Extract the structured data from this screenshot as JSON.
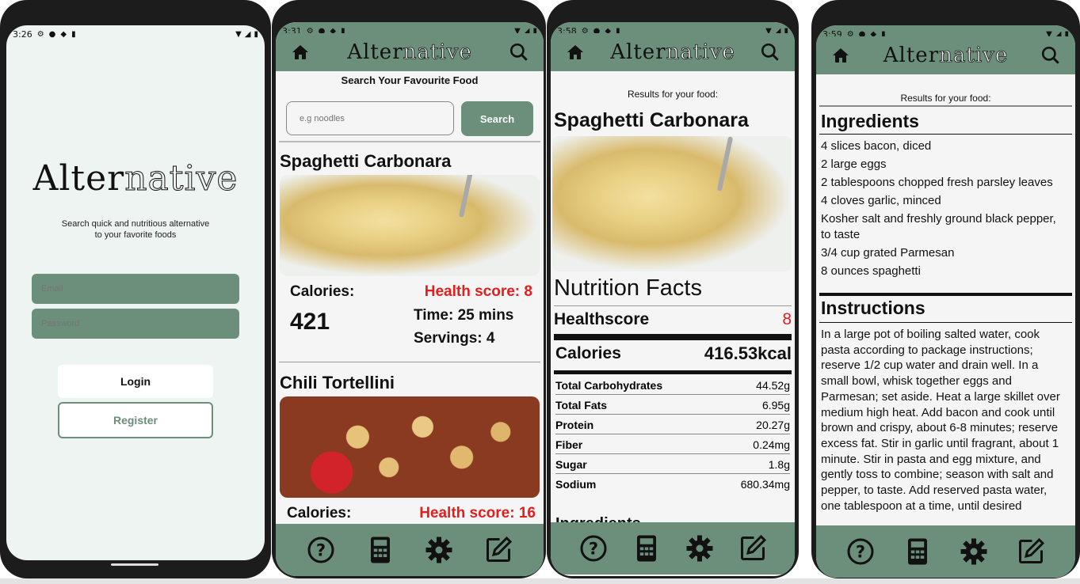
{
  "colors": {
    "primary": "#6c8f7b",
    "health_red": "#e02020",
    "screen_bg_login": "#eef4f2",
    "screen_bg": "#f5f5f5"
  },
  "brand": {
    "logo_solid": "Alter",
    "logo_outline": "native"
  },
  "screen1": {
    "time": "3:26",
    "tagline": "Search quick and nutritious alternative\nto your favorite foods",
    "email_placeholder": "Email",
    "password_placeholder": "Password",
    "login_label": "Login",
    "register_label": "Register"
  },
  "screen2": {
    "time": "3:31",
    "heading": "Search Your Favourite Food",
    "search_placeholder": "e.g noodles",
    "search_button": "Search",
    "results": [
      {
        "title": "Spaghetti Carbonara",
        "calories_label": "Calories:",
        "calories": "421",
        "health": "Health score: 8",
        "time": "Time: 25 mins",
        "servings": "Servings: 4"
      },
      {
        "title": "Chili Tortellini",
        "calories_label": "Calories:",
        "health": "Health score: 16"
      }
    ]
  },
  "screen3": {
    "time": "3:58",
    "results_label": "Results for your food:",
    "title": "Spaghetti Carbonara",
    "nutrition_heading": "Nutrition Facts",
    "healthscore_label": "Healthscore",
    "healthscore_value": "8",
    "calories_label": "Calories",
    "calories_value": "416.53kcal",
    "rows": [
      {
        "label": "Total Carbohydrates",
        "value": "44.52g"
      },
      {
        "label": "Total Fats",
        "value": "6.95g"
      },
      {
        "label": "Protein",
        "value": "20.27g"
      },
      {
        "label": "Fiber",
        "value": "0.24mg"
      },
      {
        "label": "Sugar",
        "value": "1.8g"
      },
      {
        "label": "Sodium",
        "value": "680.34mg"
      }
    ],
    "cut_heading": "Ingredients"
  },
  "screen4": {
    "time": "3:59",
    "results_label": "Results for your food:",
    "ingredients_heading": "Ingredients",
    "ingredients": [
      "4 slices bacon, diced",
      "2 large eggs",
      "2 tablespoons chopped fresh parsley leaves",
      "4 cloves garlic, minced",
      "Kosher salt and freshly ground black pepper, to taste",
      "3/4 cup grated Parmesan",
      "8 ounces spaghetti"
    ],
    "instructions_heading": "Instructions",
    "instructions": "In a large pot of boiling salted water, cook pasta according to package instructions; reserve 1/2 cup water and drain well. In a small bowl, whisk together eggs and Parmesan; set aside. Heat a large skillet over medium high heat. Add bacon and cook until brown and crispy, about 6-8 minutes; reserve excess fat. Stir in garlic until fragrant, about 1 minute. Stir in pasta and egg mixture, and gently toss to combine; season with salt and pepper, to taste. Add reserved pasta water, one tablespoon at a time, until desired"
  },
  "icons": {
    "appbar": [
      "home-icon",
      "search-icon"
    ],
    "nav": [
      "help-icon",
      "calculator-icon",
      "settings-icon",
      "edit-icon"
    ],
    "status": [
      "settings-small-icon",
      "android-icon",
      "shield-icon",
      "clipboard-icon",
      "wifi-icon",
      "signal-icon",
      "battery-icon"
    ]
  }
}
